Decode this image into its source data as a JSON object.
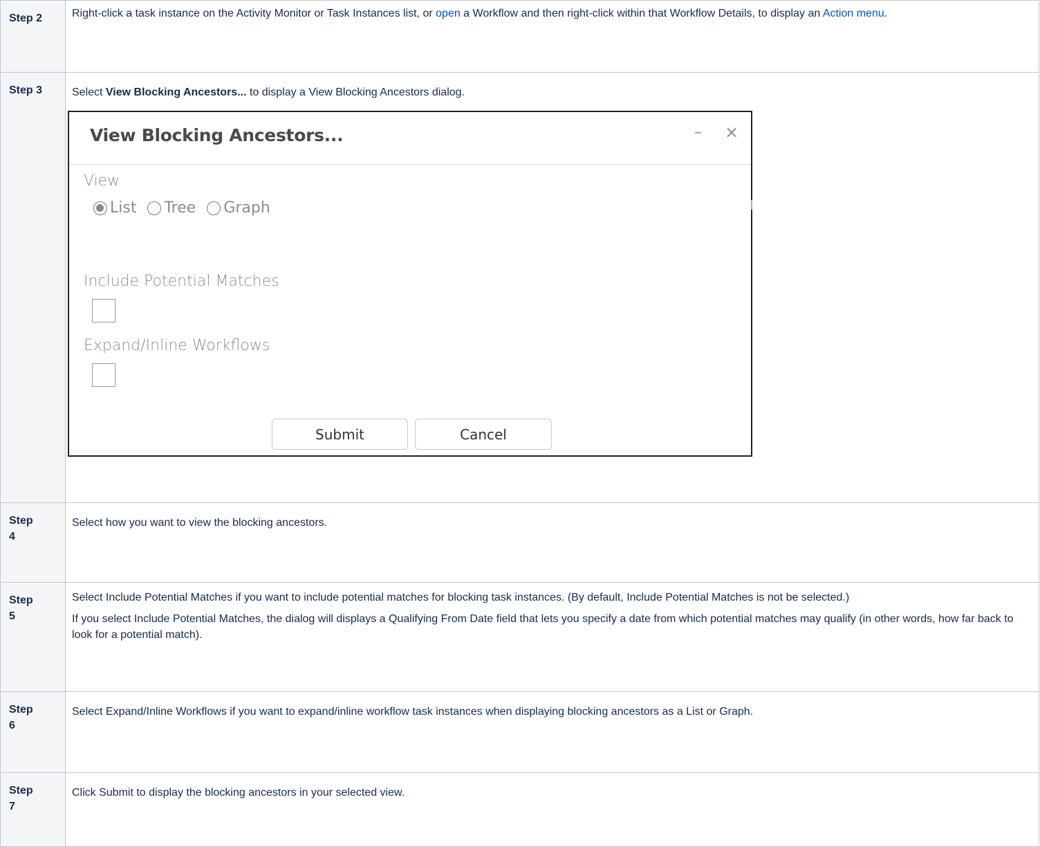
{
  "steps": [
    {
      "label": [
        "Step 2"
      ],
      "text_before_open": "Right-click a task instance on the Activity Monitor or Task Instances list, or ",
      "open_link": "open",
      "text_after_open": " a Workflow and then right-click within that Workflow Details, to display an ",
      "action_menu_link": "Action menu",
      "text_end": "."
    },
    {
      "label": [
        "Step 3"
      ],
      "text_before_bold": "Select ",
      "bold": "View Blocking Ancestors...",
      "text_after_bold": " to display a View Blocking Ancestors dialog."
    },
    {
      "label": [
        "Step",
        "4"
      ],
      "text": "Select how you want to view the blocking ancestors."
    },
    {
      "label": [
        "Step",
        "5"
      ],
      "para1": "Select Include Potential Matches if you want to include potential matches for blocking task instances. (By default, Include Potential Matches is not be selected.)",
      "para2": "If you select Include Potential Matches, the dialog will displays a Qualifying From Date field that lets you specify a date from which potential matches may qualify (in other words, how far back to look for a potential match)."
    },
    {
      "label": [
        "Step",
        "6"
      ],
      "text": "Select Expand/Inline Workflows if you want to expand/inline workflow task instances when displaying blocking ancestors as a List or Graph."
    },
    {
      "label": [
        "Step",
        "7"
      ],
      "text": "Click Submit to display the blocking ancestors in your selected view."
    }
  ],
  "dialog": {
    "title": "View Blocking Ancestors...",
    "minimize": "–",
    "close": "×",
    "view_label": "View",
    "radio_options": [
      {
        "label": "List",
        "selected": true
      },
      {
        "label": "Tree",
        "selected": false
      },
      {
        "label": "Graph",
        "selected": false
      }
    ],
    "include_potential_label": "Include Potential Matches",
    "include_potential_checked": false,
    "expand_inline_label": "Expand/Inline Workflows",
    "expand_inline_checked": false,
    "submit_label": "Submit",
    "cancel_label": "Cancel"
  },
  "colors": {
    "link": "#0052cc",
    "step_label_bg": "#f4f5f7",
    "border": "#c1c7d0"
  }
}
